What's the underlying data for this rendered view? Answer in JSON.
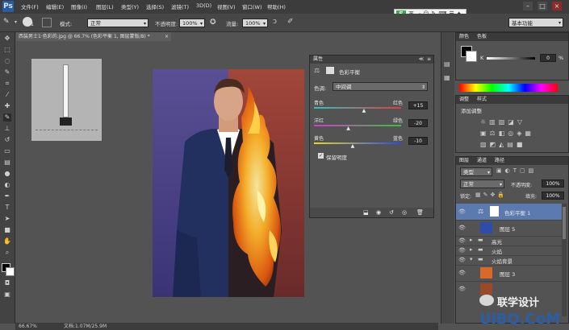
{
  "app": {
    "logo": "Ps",
    "menu": [
      "文件(F)",
      "编辑(E)",
      "图像(I)",
      "图层(L)",
      "类型(Y)",
      "选择(S)",
      "滤镜(T)",
      "3D(D)",
      "视图(V)",
      "窗口(W)",
      "帮助(H)"
    ],
    "window_controls": [
      "–",
      "□",
      "×"
    ]
  },
  "options": {
    "mode_label": "模式:",
    "mode_value": "正常",
    "opacity_label": "不透明度:",
    "opacity_value": "100%",
    "flow_label": "流量:",
    "flow_value": "100%",
    "brush_size": "1",
    "workspace": "基本功能"
  },
  "document": {
    "tab_title": "西装男士1·色彩的.jpg @ 66.7% (色彩平衡 1, 图层蒙版/8) *",
    "tab_close": "×",
    "zoom": "66.67%",
    "doc_size": "文档:1.07M/25.9M"
  },
  "properties": {
    "tab": "属性",
    "title": "色彩平衡",
    "tone_label": "色调:",
    "tone_value": "中间调",
    "sliders": [
      {
        "left": "青色",
        "right": "红色",
        "value": "+15",
        "fraction": 0.58
      },
      {
        "left": "洋红",
        "right": "绿色",
        "value": "-20",
        "fraction": 0.4
      },
      {
        "left": "黄色",
        "right": "蓝色",
        "value": "-10",
        "fraction": 0.45
      }
    ],
    "preserve_label": "保留明度",
    "preserve_checked": "✓"
  },
  "color_panel": {
    "tabs": [
      "颜色",
      "色板"
    ],
    "k_label": "K",
    "k_value": "0",
    "k_unit": "%"
  },
  "adjustments_panel": {
    "tabs": [
      "调整",
      "样式"
    ],
    "title": "添加调整"
  },
  "layers_panel": {
    "tabs": [
      "图层",
      "通道",
      "路径"
    ],
    "filter_value": "类型",
    "blend_value": "正常",
    "opacity_label": "不透明度:",
    "opacity_value": "100%",
    "lock_label": "锁定:",
    "fill_label": "填充:",
    "fill_value": "100%",
    "layers": [
      {
        "name": "色彩平衡 1",
        "type": "adjustment",
        "selected": true
      },
      {
        "name": "图层 5",
        "type": "image",
        "selected": false
      },
      {
        "name": "高光",
        "type": "group",
        "selected": false
      },
      {
        "name": "火焰",
        "type": "group",
        "selected": false
      },
      {
        "name": "火焰背景",
        "type": "group",
        "selected": false
      },
      {
        "name": "图层 3",
        "type": "image",
        "selected": false
      }
    ]
  },
  "watermark": {
    "line1": "联学设计",
    "line2": "UiBQ.CoM"
  },
  "ime": {
    "label": "S",
    "mode": "英"
  },
  "colors": {
    "accent": "#4a77b5",
    "selected_layer": "#5b7bb0",
    "panel_bg": "#535353",
    "menu_bg": "#3c3c3c"
  }
}
